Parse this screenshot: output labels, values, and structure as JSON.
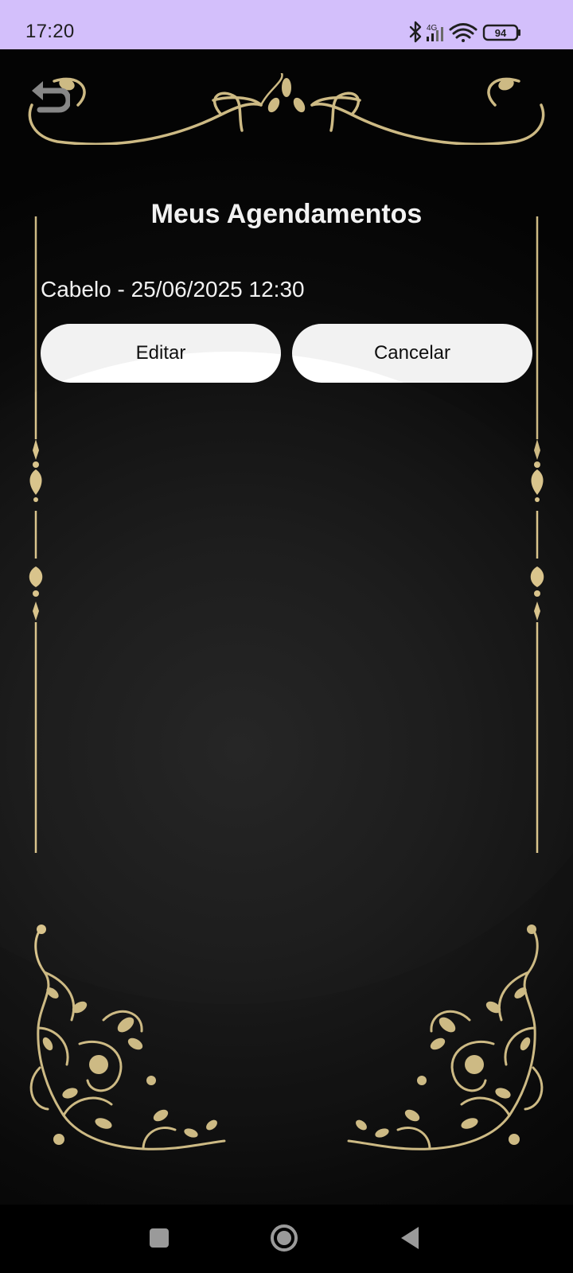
{
  "status_bar": {
    "time": "17:20",
    "network": "4G",
    "battery": "94",
    "icons": [
      "bluetooth-icon",
      "signal-icon",
      "wifi-icon",
      "battery-icon"
    ]
  },
  "screen": {
    "title": "Meus Agendamentos",
    "back_icon": "undo-arrow-icon"
  },
  "appointments": [
    {
      "text": "Cabelo - 25/06/2025 12:30",
      "edit_label": "Editar",
      "cancel_label": "Cancelar"
    }
  ],
  "navigation": {
    "items": [
      "recent-apps-icon",
      "home-icon",
      "back-icon"
    ]
  },
  "colors": {
    "gold": "#d9c48c",
    "status_bar": "#d3bffb",
    "button_bg": "#ffffff"
  }
}
